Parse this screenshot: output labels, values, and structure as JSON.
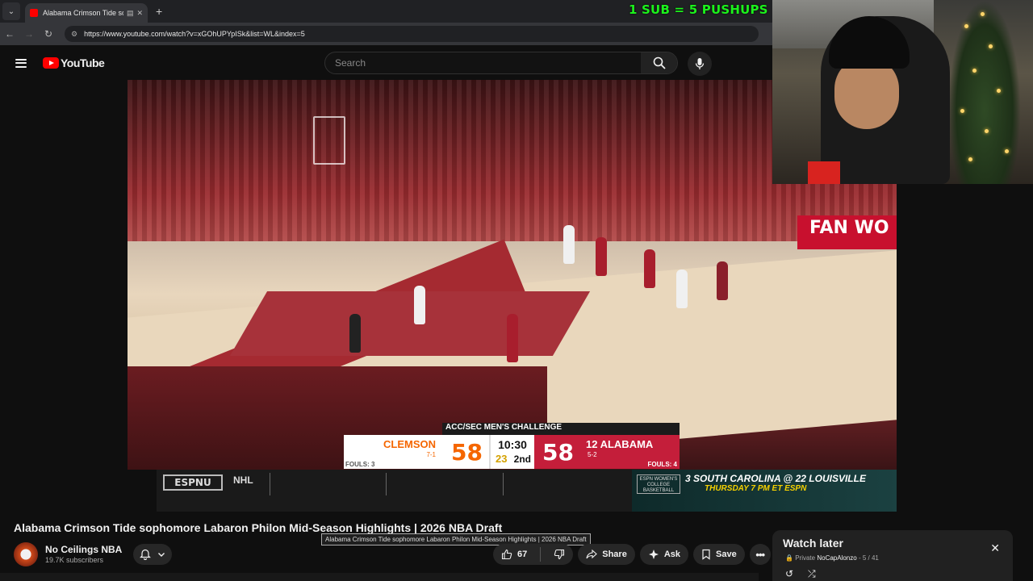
{
  "browser": {
    "tab_title": "Alabama Crimson Tide sop",
    "url": "https://www.youtube.com/watch?v=xGOhUPYpISk&list=WL&index=5"
  },
  "overlay": {
    "sub_text": "1 SUB = 5 PUSHUPS",
    "color": "#1cf21c"
  },
  "youtube": {
    "logo_text": "YouTube",
    "search_placeholder": "Search"
  },
  "video": {
    "court_text": "FAN WO",
    "scorebug": {
      "header": "ACC/SEC MEN'S CHALLENGE",
      "home": {
        "name": "CLEMSON",
        "record": "7-1",
        "score": "58",
        "fouls": "FOULS: 3",
        "color": "#f56600"
      },
      "clock": "10:30",
      "shot_clock": "23",
      "period": "2nd",
      "away": {
        "name": "12 ALABAMA",
        "record": "5-2",
        "score": "58",
        "fouls": "FOULS: 4",
        "color": "#c41e3a"
      }
    },
    "ticker": {
      "network": "ESPNU",
      "league": "NHL",
      "promo_brand": "ESPN WOMEN'S COLLEGE BASKETBALL",
      "promo_line1": "3 SOUTH CAROLINA @ 22 LOUISVILLE",
      "promo_line2": "THURSDAY 7 PM ET ESPN"
    }
  },
  "details": {
    "title": "Alabama Crimson Tide sophomore Labaron Philon Mid-Season Highlights | 2026 NBA Draft",
    "tooltip": "Alabama Crimson Tide sophomore Labaron Philon Mid-Season Highlights | 2026 NBA Draft",
    "channel_name": "No Ceilings NBA",
    "subscribers": "19.7K subscribers",
    "likes": "67",
    "share_label": "Share",
    "ask_label": "Ask",
    "save_label": "Save"
  },
  "playlist": {
    "title": "Watch later",
    "privacy": "Private",
    "owner": "NoCapAlonzo",
    "position": "5 / 41"
  }
}
